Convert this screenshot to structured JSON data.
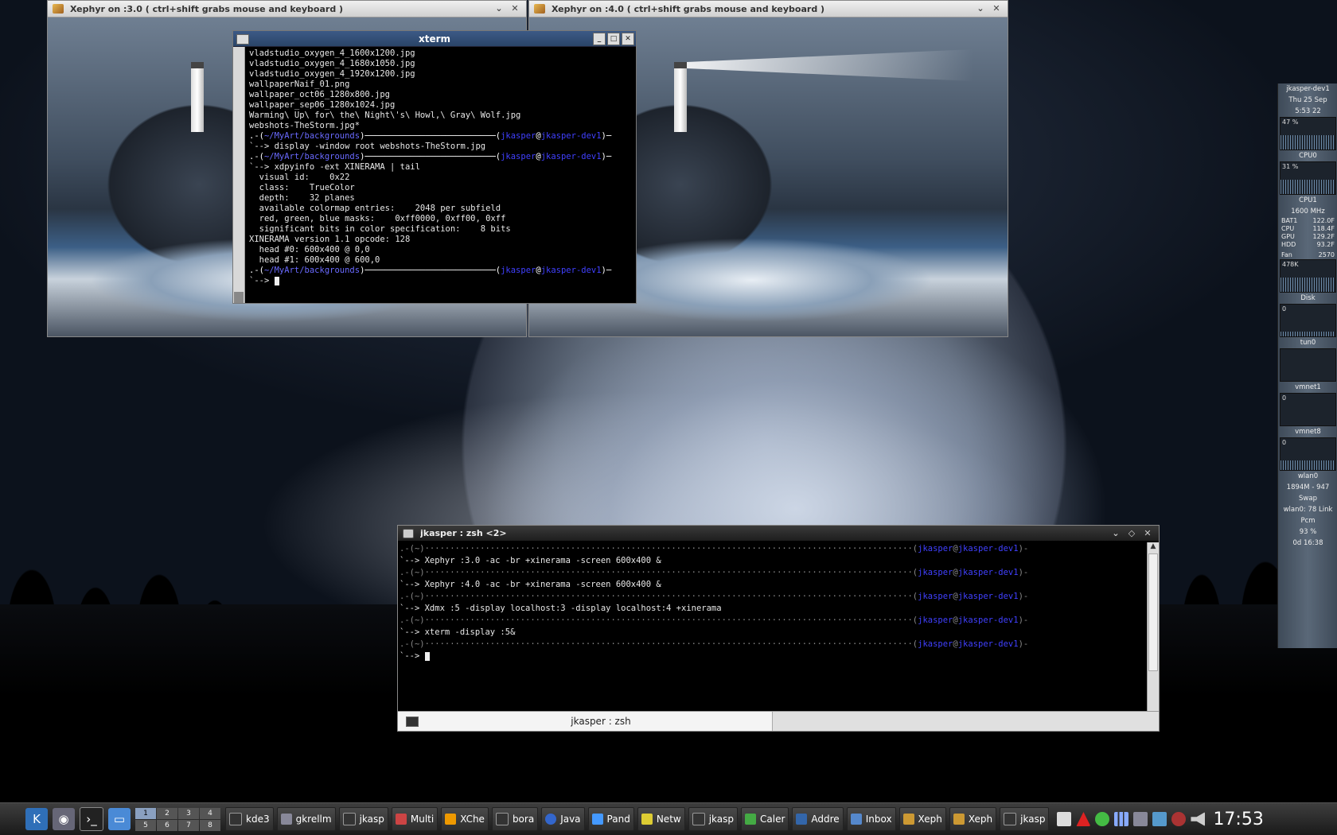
{
  "xephyr_left": {
    "title": "Xephyr on :3.0 ( ctrl+shift grabs mouse and keyboard )"
  },
  "xephyr_right": {
    "title": "Xephyr on :4.0 ( ctrl+shift grabs mouse and keyboard )"
  },
  "xterm": {
    "title": "xterm",
    "lines": [
      "vladstudio_oxygen_4_1600x1200.jpg",
      "vladstudio_oxygen_4_1680x1050.jpg",
      "vladstudio_oxygen_4_1920x1200.jpg",
      "wallpaperNaif_01.png",
      "wallpaper_oct06_1280x800.jpg",
      "wallpaper_sep06_1280x1024.jpg",
      "Warming\\ Up\\ for\\ the\\ Night\\'s\\ Howl,\\ Gray\\ Wolf.jpg",
      "webshots-TheStorm.jpg*"
    ],
    "prompt_path": "~/MyArt/backgrounds",
    "prompt_user": "jkasper",
    "prompt_host": "jkasper-dev1",
    "cmd1": "display -window root webshots-TheStorm.jpg",
    "cmd2": "xdpyinfo -ext XINERAMA | tail",
    "output": [
      "  visual id:    0x22",
      "  class:    TrueColor",
      "  depth:    32 planes",
      "  available colormap entries:    2048 per subfield",
      "  red, green, blue masks:    0xff0000, 0xff00, 0xff",
      "  significant bits in color specification:    8 bits",
      "",
      "XINERAMA version 1.1 opcode: 128",
      "  head #0: 600x400 @ 0,0",
      "  head #1: 600x400 @ 600,0"
    ]
  },
  "zsh": {
    "title": "jkasper : zsh <2>",
    "user": "jkasper",
    "host": "jkasper-dev1",
    "commands": [
      "Xephyr :3.0 -ac -br +xinerama -screen 600x400 &",
      "Xephyr :4.0 -ac -br +xinerama -screen 600x400 &",
      "Xdmx :5 -display localhost:3 -display localhost:4 +xinerama",
      "xterm -display :5&"
    ],
    "tab_label": "jkasper : zsh"
  },
  "gkrellm": {
    "host": "jkasper-dev1",
    "date": "Thu 25 Sep",
    "time": "5:53 22",
    "cpu0_pct": "47 %",
    "cpu0_label": "CPU0",
    "cpu1_pct": "31 %",
    "cpu1_label": "CPU1",
    "freq": "1600 MHz",
    "sensors": [
      {
        "k": "BAT1",
        "v": "122.0F"
      },
      {
        "k": "CPU",
        "v": "118.4F"
      },
      {
        "k": "GPU",
        "v": "129.2F"
      },
      {
        "k": "HDD",
        "v": "93.2F"
      },
      {
        "k": "Fan",
        "v": "2570"
      }
    ],
    "proc": "478K",
    "disk_label": "Disk",
    "disk_val": "0",
    "net": [
      {
        "name": "tun0",
        "val": ""
      },
      {
        "name": "vmnet1",
        "val": "0"
      },
      {
        "name": "vmnet8",
        "val": "0"
      },
      {
        "name": "wlan0",
        "val": "1894M - 947"
      }
    ],
    "swap": "Swap",
    "wlan_link": "wlan0: 78 Link",
    "pcm": "Pcm",
    "battery": "93 %",
    "uptime": "0d 16:38"
  },
  "taskbar": {
    "pager": [
      "1",
      "2",
      "3",
      "4",
      "5",
      "6",
      "7",
      "8"
    ],
    "tasks": [
      "kde3",
      "gkrellm",
      "jkasp",
      "Multi",
      "XChe",
      "bora",
      "Java",
      "Pand",
      "Netw",
      "jkasp",
      "Caler",
      "Addre",
      "Inbox",
      "Xeph",
      "Xeph",
      "jkasp"
    ],
    "clock": "17:53"
  }
}
